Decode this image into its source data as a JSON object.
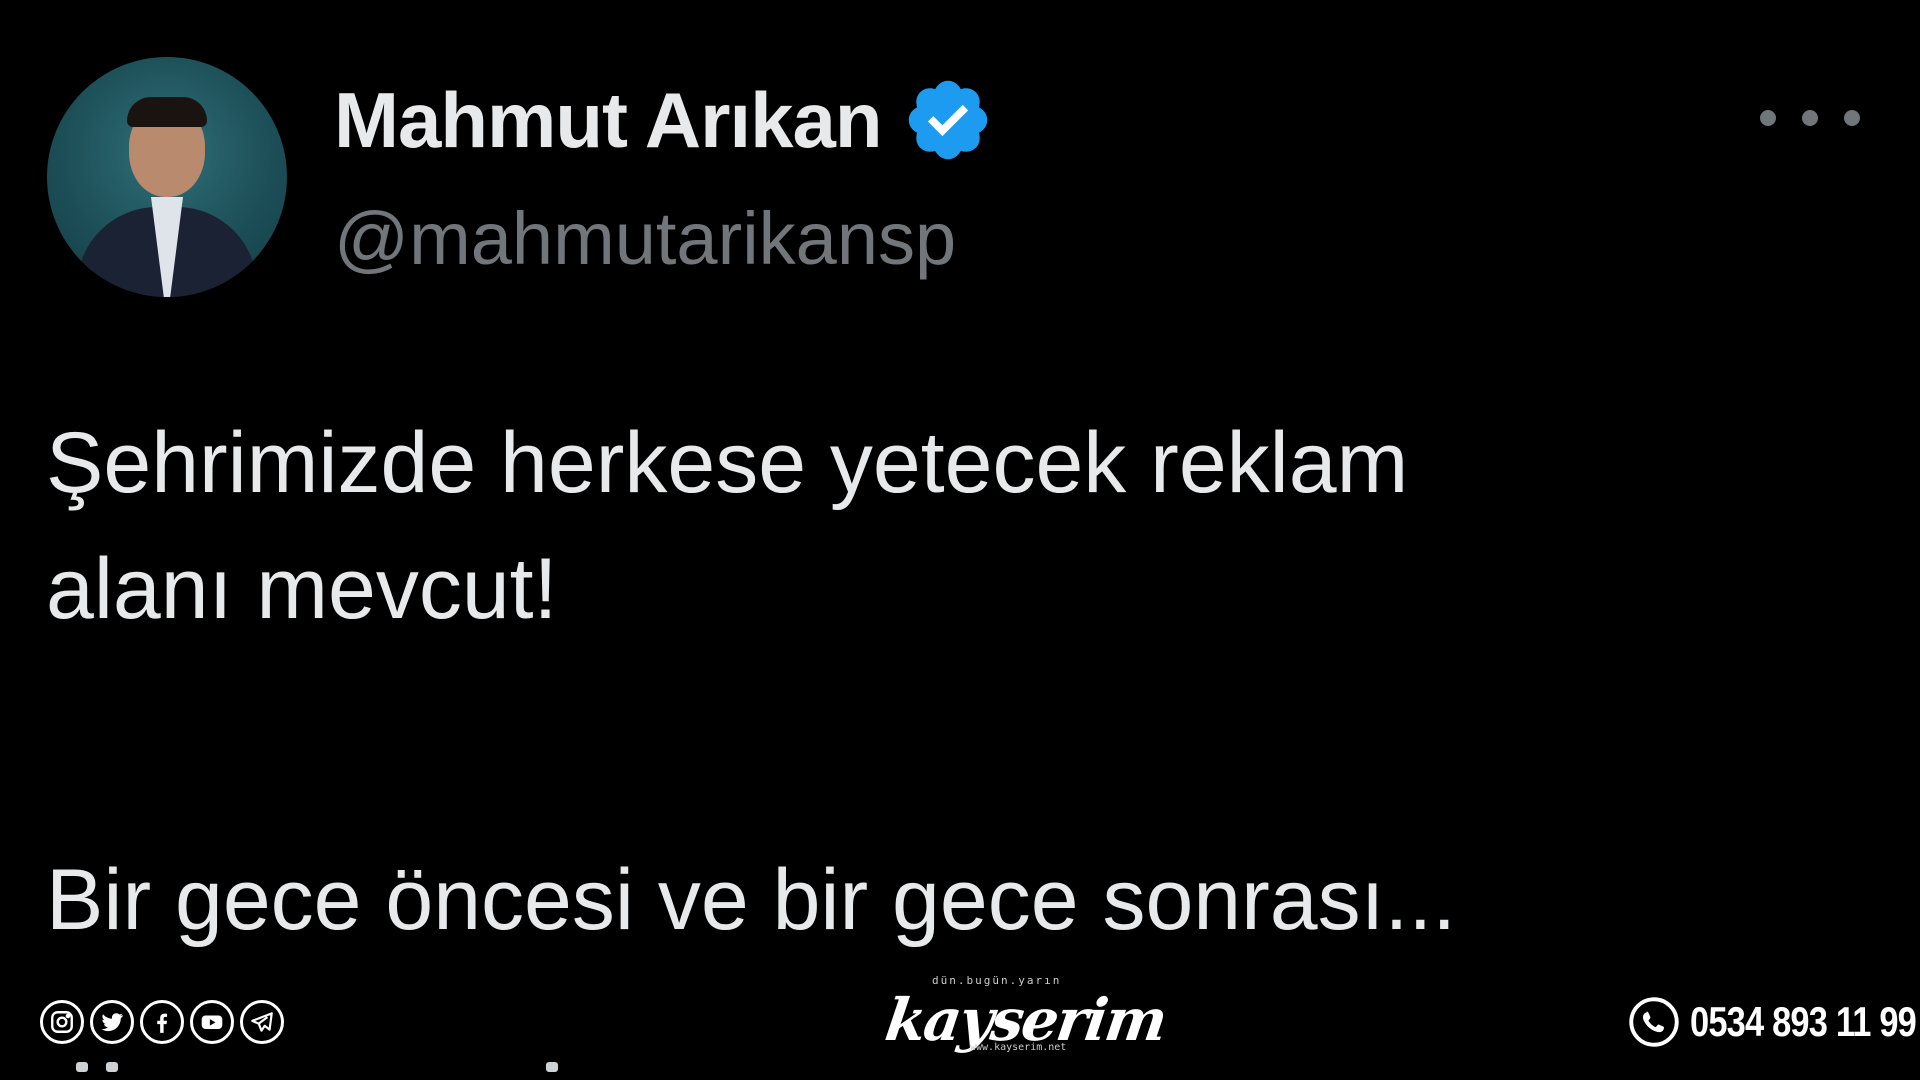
{
  "tweet": {
    "author": {
      "display_name": "Mahmut Arıkan",
      "handle": "@mahmutarikansp",
      "verified": true
    },
    "text_lines": [
      "Şehrimizde herkese yetecek reklam",
      "alanı mevcut!",
      "Bir gece öncesi ve bir gece sonrası..."
    ]
  },
  "footer": {
    "social_icons": [
      "instagram-icon",
      "twitter-icon",
      "facebook-icon",
      "youtube-icon",
      "telegram-icon"
    ],
    "brand": {
      "tagline": "dün.bugün.yarın",
      "name": "kayserim",
      "url": "www.kayserim.net"
    },
    "phone": "0534 893 11 99"
  },
  "colors": {
    "background": "#000000",
    "text_primary": "#e7e9ea",
    "text_secondary": "#71767b",
    "verified_blue": "#1d9bf0"
  }
}
